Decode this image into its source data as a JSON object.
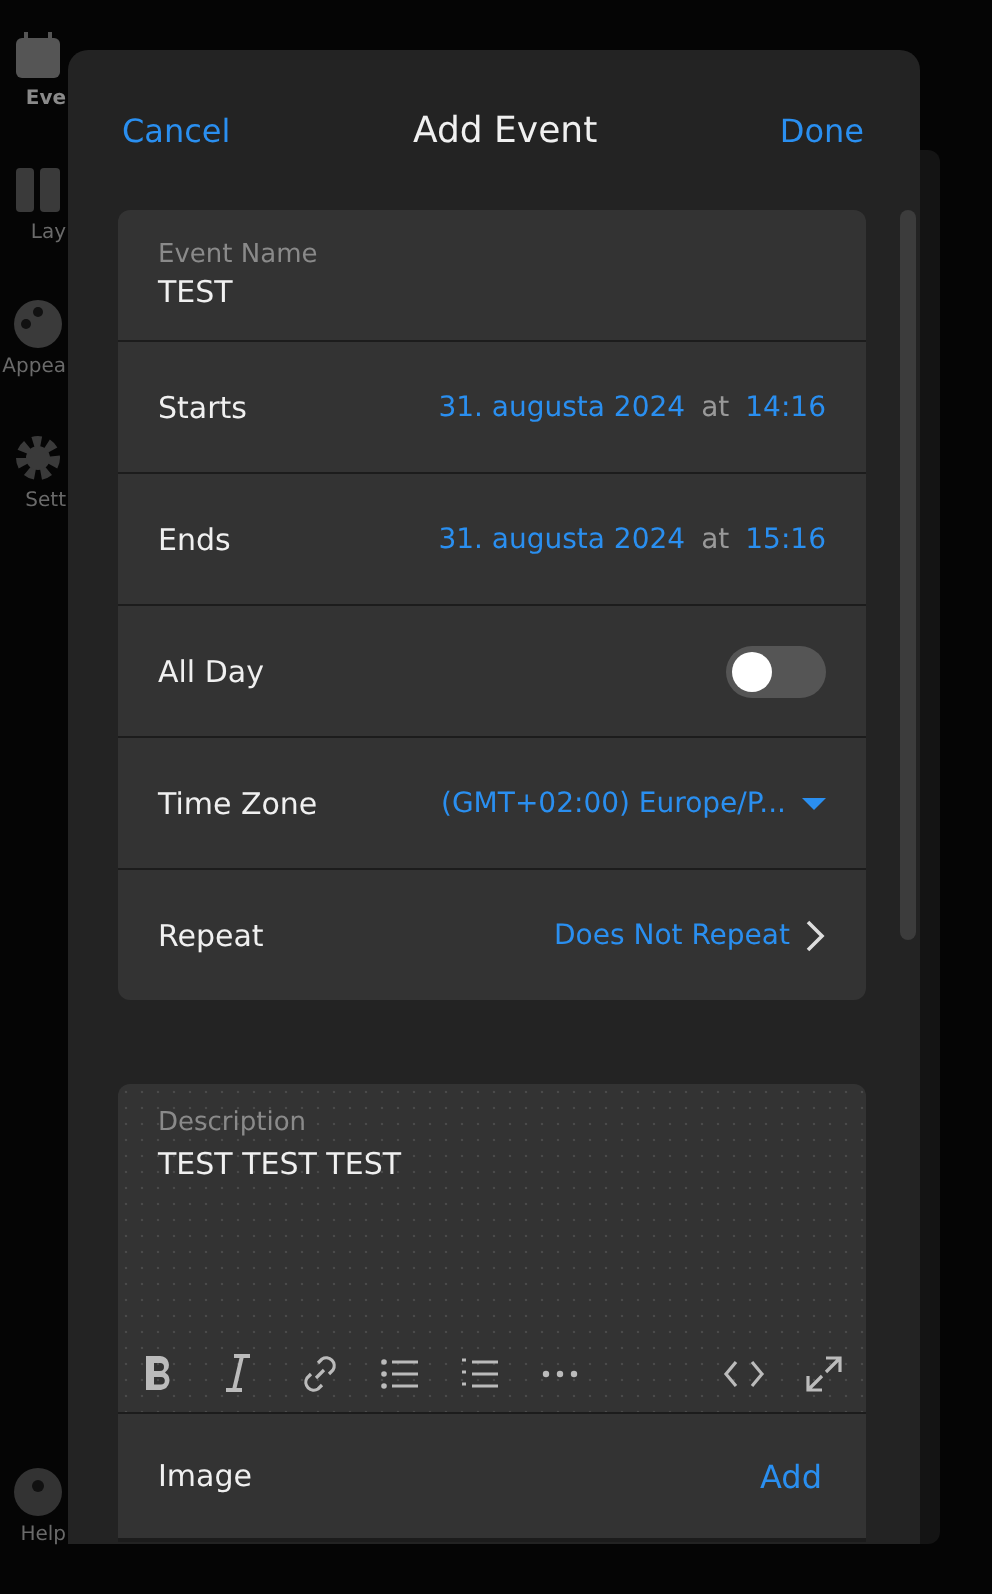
{
  "sidebar": {
    "items": [
      {
        "label": "Eve",
        "selected": true
      },
      {
        "label": "Lay",
        "selected": false
      },
      {
        "label": "Appea",
        "selected": false
      },
      {
        "label": "Sett",
        "selected": false
      },
      {
        "label": "Help",
        "selected": false
      }
    ]
  },
  "dialog": {
    "title": "Add Event",
    "cancel": "Cancel",
    "done": "Done",
    "event_name": {
      "label": "Event Name",
      "value": "TEST"
    },
    "rows": [
      {
        "kind": "datetime",
        "label": "Starts",
        "date": "31. augusta 2024",
        "at": "at",
        "time": "14:16"
      },
      {
        "kind": "datetime",
        "label": "Ends",
        "date": "31. augusta 2024",
        "at": "at",
        "time": "15:16"
      },
      {
        "kind": "toggle",
        "label": "All Day",
        "on": false
      },
      {
        "kind": "dropdown",
        "label": "Time Zone",
        "value": "(GMT+02:00) Europe/P..."
      },
      {
        "kind": "link",
        "label": "Repeat",
        "value": "Does Not Repeat"
      }
    ],
    "description": {
      "label": "Description",
      "value": "TEST TEST TEST"
    },
    "image": {
      "label": "Image",
      "action": "Add"
    }
  }
}
